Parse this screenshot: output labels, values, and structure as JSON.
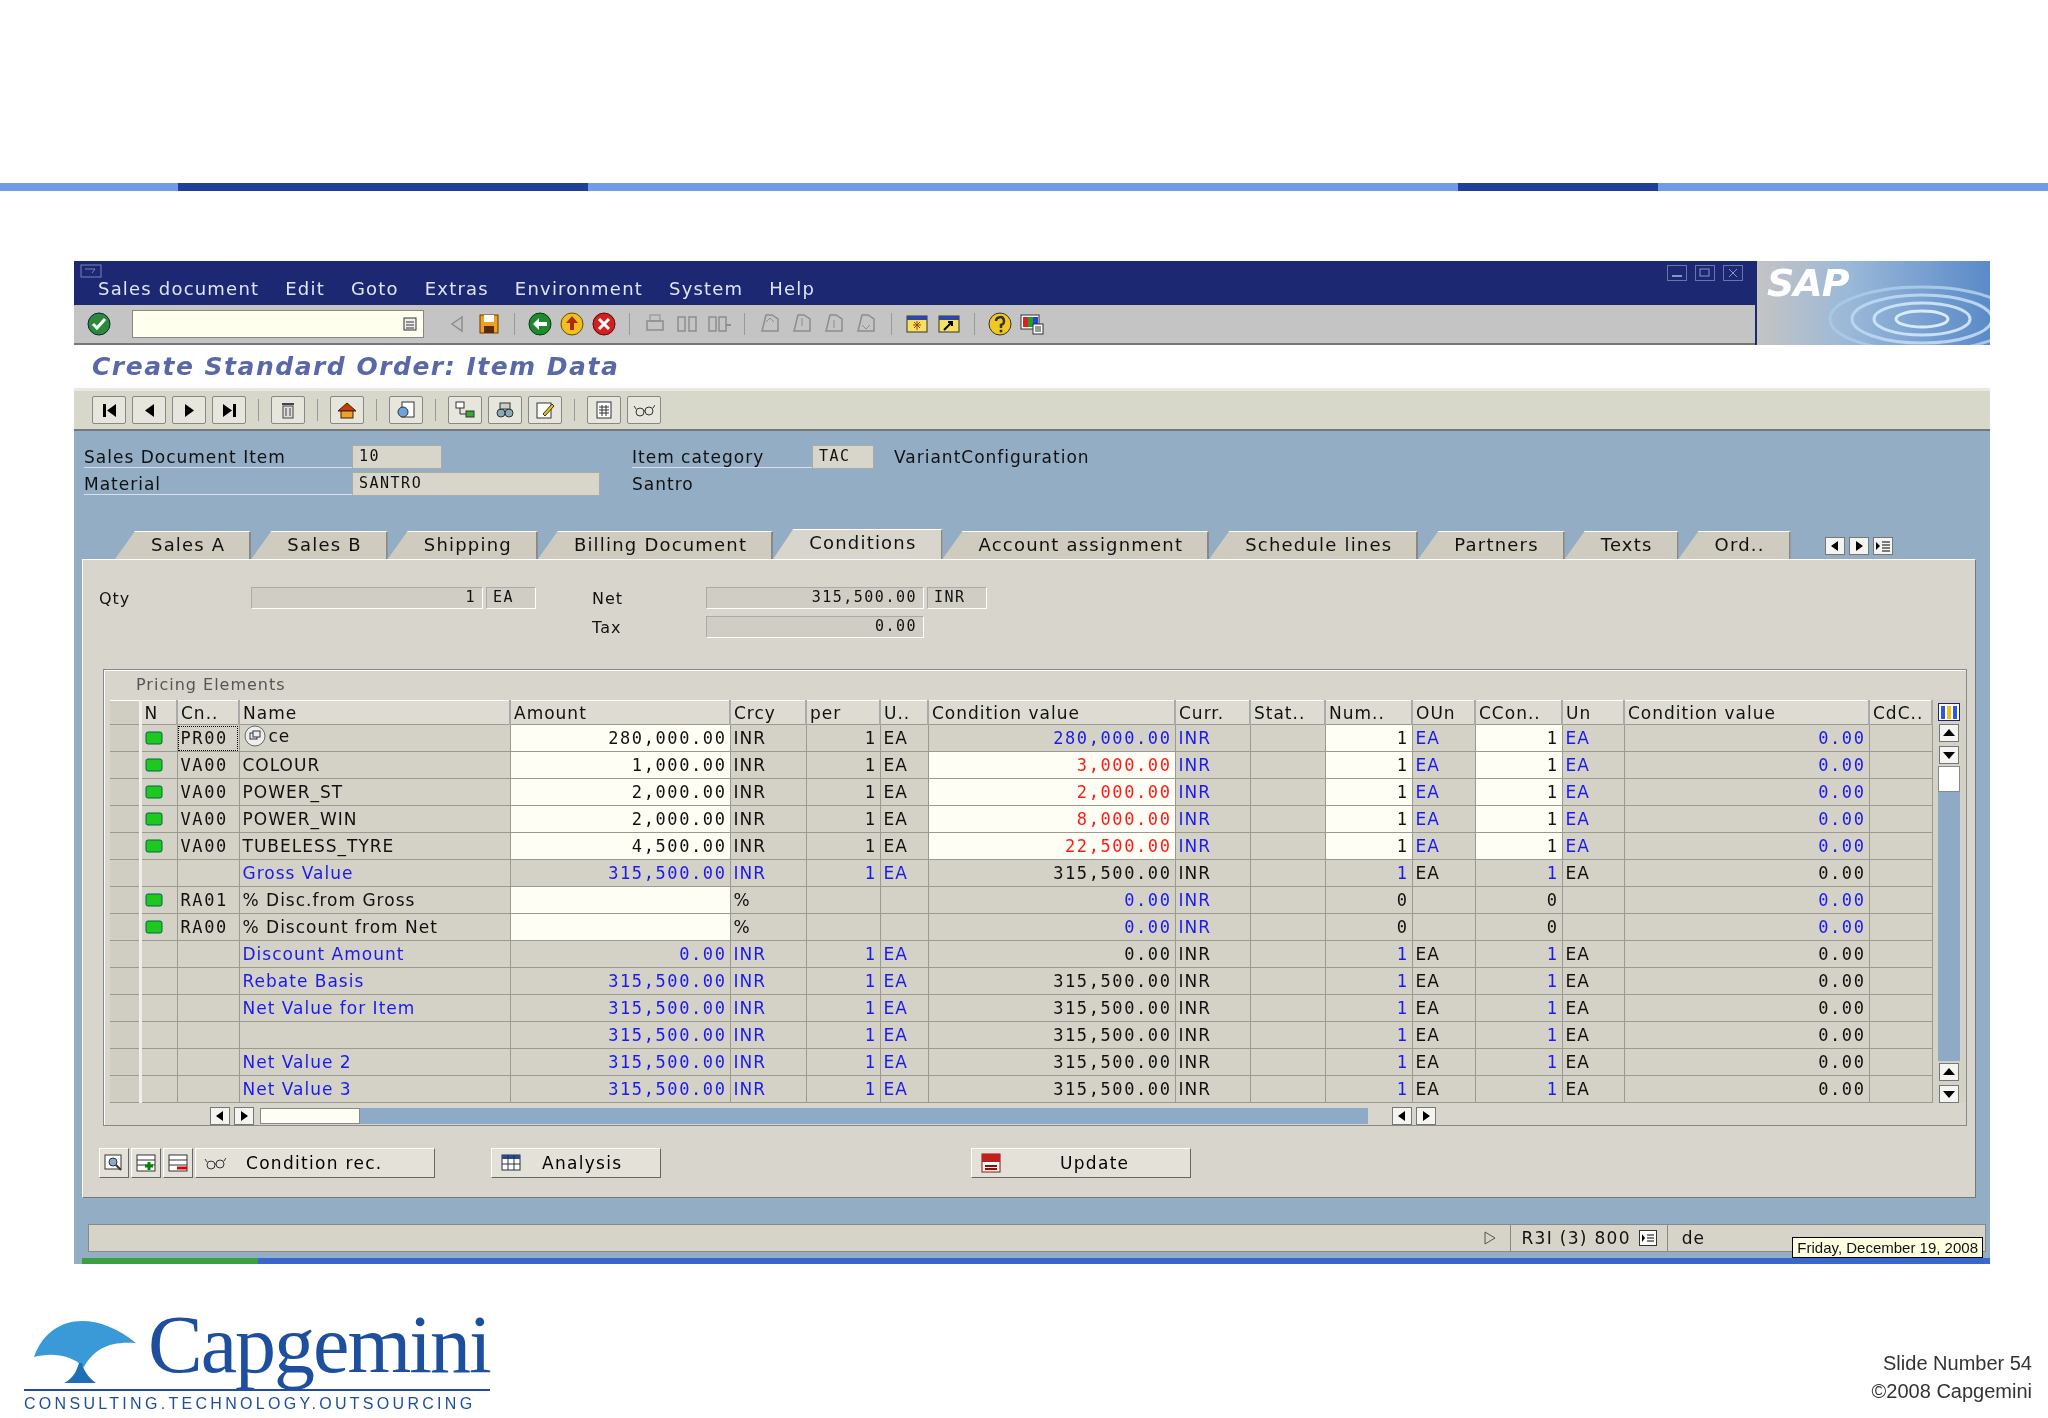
{
  "menu": [
    "Sales document",
    "Edit",
    "Goto",
    "Extras",
    "Environment",
    "System",
    "Help"
  ],
  "logo": "SAP",
  "title": "Create Standard Order: Item Data",
  "header": {
    "item_label": "Sales Document Item",
    "item_value": "10",
    "material_label": "Material",
    "material_value": "SANTRO",
    "category_label": "Item category",
    "category_value": "TAC",
    "category_description": "VariantConfiguration",
    "material_description": "Santro"
  },
  "tabs": [
    {
      "label": "Sales A",
      "selected": false
    },
    {
      "label": "Sales B",
      "selected": false
    },
    {
      "label": "Shipping",
      "selected": false
    },
    {
      "label": "Billing Document",
      "selected": false
    },
    {
      "label": "Conditions",
      "selected": true
    },
    {
      "label": "Account assignment",
      "selected": false
    },
    {
      "label": "Schedule lines",
      "selected": false
    },
    {
      "label": "Partners",
      "selected": false
    },
    {
      "label": "Texts",
      "selected": false
    },
    {
      "label": "Ord..",
      "selected": false
    }
  ],
  "summary": {
    "qty_label": "Qty",
    "qty_value": "1",
    "qty_unit": "EA",
    "net_label": "Net",
    "net_value": "315,500.00",
    "net_currency": "INR",
    "tax_label": "Tax",
    "tax_value": "0.00"
  },
  "pricing": {
    "title": "Pricing Elements",
    "columns": [
      "N",
      "Cn..",
      "Name",
      "Amount",
      "Crcy",
      "per",
      "U..",
      "Condition value",
      "Curr.",
      "Stat..",
      "Num..",
      "OUn",
      "CCon..",
      "Un",
      "Condition value",
      "CdC.."
    ],
    "rows": [
      {
        "kind": "price",
        "focused": true,
        "cn": "PR00",
        "name": "ce",
        "amount": "280,000.00",
        "crcy": "INR",
        "per": "1",
        "unit": "EA",
        "condition_value": "280,000.00",
        "curr": "INR",
        "num": "1",
        "oun": "EA",
        "ccon": "1",
        "un": "EA",
        "condition_value_2": "0.00"
      },
      {
        "kind": "surcharge",
        "focused": false,
        "cn": "VA00",
        "name": "COLOUR",
        "amount": "1,000.00",
        "crcy": "INR",
        "per": "1",
        "unit": "EA",
        "condition_value": "3,000.00",
        "curr": "INR",
        "num": "1",
        "oun": "EA",
        "ccon": "1",
        "un": "EA",
        "condition_value_2": "0.00"
      },
      {
        "kind": "surcharge",
        "focused": false,
        "cn": "VA00",
        "name": "POWER_ST",
        "amount": "2,000.00",
        "crcy": "INR",
        "per": "1",
        "unit": "EA",
        "condition_value": "2,000.00",
        "curr": "INR",
        "num": "1",
        "oun": "EA",
        "ccon": "1",
        "un": "EA",
        "condition_value_2": "0.00"
      },
      {
        "kind": "surcharge",
        "focused": false,
        "cn": "VA00",
        "name": "POWER_WIN",
        "amount": "2,000.00",
        "crcy": "INR",
        "per": "1",
        "unit": "EA",
        "condition_value": "8,000.00",
        "curr": "INR",
        "num": "1",
        "oun": "EA",
        "ccon": "1",
        "un": "EA",
        "condition_value_2": "0.00"
      },
      {
        "kind": "surcharge",
        "focused": false,
        "cn": "VA00",
        "name": "TUBELESS_TYRE",
        "amount": "4,500.00",
        "crcy": "INR",
        "per": "1",
        "unit": "EA",
        "condition_value": "22,500.00",
        "curr": "INR",
        "num": "1",
        "oun": "EA",
        "ccon": "1",
        "un": "EA",
        "condition_value_2": "0.00"
      },
      {
        "kind": "subtotal",
        "focused": false,
        "name": "Gross Value",
        "amount": "315,500.00",
        "crcy": "INR",
        "per": "1",
        "unit": "EA",
        "condition_value": "315,500.00",
        "curr": "INR",
        "num": "1",
        "oun": "EA",
        "ccon": "1",
        "un": "EA",
        "condition_value_2": "0.00"
      },
      {
        "kind": "discount",
        "focused": false,
        "cn": "RA01",
        "name": "% Disc.from Gross",
        "crcy": "%",
        "condition_value": "0.00",
        "curr": "INR",
        "num": "0",
        "ccon": "0",
        "condition_value_2": "0.00"
      },
      {
        "kind": "discount",
        "focused": false,
        "cn": "RA00",
        "name": "% Discount from Net",
        "crcy": "%",
        "condition_value": "0.00",
        "curr": "INR",
        "num": "0",
        "ccon": "0",
        "condition_value_2": "0.00"
      },
      {
        "kind": "subtotal",
        "focused": false,
        "name": "Discount Amount",
        "amount": "0.00",
        "crcy": "INR",
        "per": "1",
        "unit": "EA",
        "condition_value": "0.00",
        "curr": "INR",
        "num": "1",
        "oun": "EA",
        "ccon": "1",
        "un": "EA",
        "condition_value_2": "0.00"
      },
      {
        "kind": "subtotal",
        "focused": false,
        "name": "Rebate Basis",
        "amount": "315,500.00",
        "crcy": "INR",
        "per": "1",
        "unit": "EA",
        "condition_value": "315,500.00",
        "curr": "INR",
        "num": "1",
        "oun": "EA",
        "ccon": "1",
        "un": "EA",
        "condition_value_2": "0.00"
      },
      {
        "kind": "subtotal",
        "focused": false,
        "name": "Net Value for Item",
        "amount": "315,500.00",
        "crcy": "INR",
        "per": "1",
        "unit": "EA",
        "condition_value": "315,500.00",
        "curr": "INR",
        "num": "1",
        "oun": "EA",
        "ccon": "1",
        "un": "EA",
        "condition_value_2": "0.00"
      },
      {
        "kind": "subtotal",
        "focused": false,
        "amount": "315,500.00",
        "crcy": "INR",
        "per": "1",
        "unit": "EA",
        "condition_value": "315,500.00",
        "curr": "INR",
        "num": "1",
        "oun": "EA",
        "ccon": "1",
        "un": "EA",
        "condition_value_2": "0.00"
      },
      {
        "kind": "subtotal",
        "focused": false,
        "name": "Net Value 2",
        "amount": "315,500.00",
        "crcy": "INR",
        "per": "1",
        "unit": "EA",
        "condition_value": "315,500.00",
        "curr": "INR",
        "num": "1",
        "oun": "EA",
        "ccon": "1",
        "un": "EA",
        "condition_value_2": "0.00"
      },
      {
        "kind": "subtotal",
        "focused": false,
        "name": "Net Value 3",
        "amount": "315,500.00",
        "crcy": "INR",
        "per": "1",
        "unit": "EA",
        "condition_value": "315,500.00",
        "curr": "INR",
        "num": "1",
        "oun": "EA",
        "ccon": "1",
        "un": "EA",
        "condition_value_2": "0.00"
      }
    ]
  },
  "buttons": {
    "condition_records": "Condition rec.",
    "analysis": "Analysis",
    "update": "Update"
  },
  "status_bar": {
    "system": "R3I (3) 800",
    "user": "de",
    "tooltip": "Friday, December 19, 2008"
  },
  "footer": {
    "brand": "Capgemini",
    "tagline": "CONSULTING.TECHNOLOGY.OUTSOURCING",
    "slide_number": "Slide Number 54",
    "copyright": "©2008 Capgemini"
  }
}
